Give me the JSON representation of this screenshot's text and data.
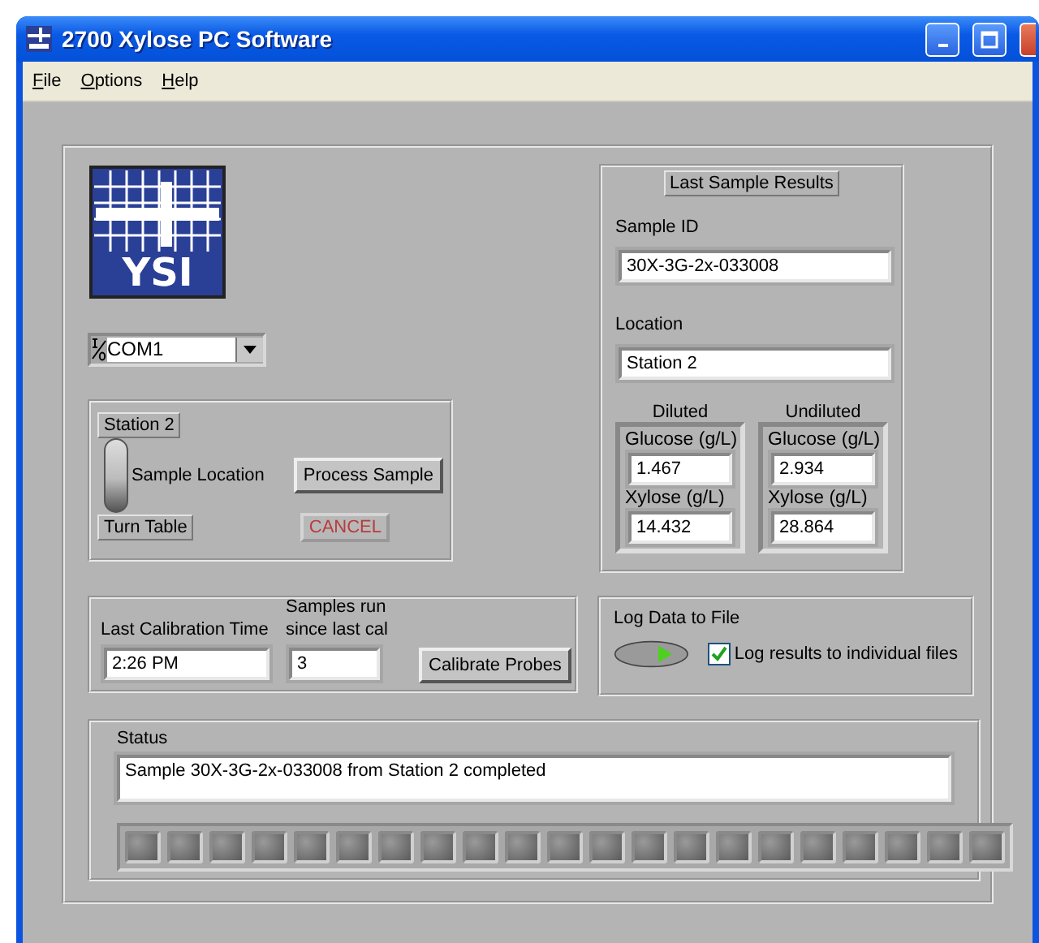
{
  "window": {
    "title": "2700 Xylose PC Software"
  },
  "menu": [
    {
      "label": "File"
    },
    {
      "label": "Options"
    },
    {
      "label": "Help"
    }
  ],
  "logo": {
    "text": "YSI"
  },
  "port": {
    "value": "COM1"
  },
  "station_panel": {
    "station_label": "Station 2",
    "switch": {
      "on": true
    },
    "switch_label": "Sample Location",
    "turntable_label": "Turn Table",
    "process_button": "Process Sample",
    "cancel_button": {
      "label": "CANCEL",
      "disabled": true
    }
  },
  "results": {
    "title": "Last Sample Results",
    "sample_id": {
      "label": "Sample ID",
      "value": "30X-3G-2x-033008"
    },
    "location": {
      "label": "Location",
      "value": "Station 2"
    },
    "groups": [
      {
        "heading": "Diluted",
        "fields": [
          {
            "label": "Glucose (g/L)",
            "value": "1.467"
          },
          {
            "label": "Xylose (g/L)",
            "value": "14.432"
          }
        ]
      },
      {
        "heading": "Undiluted",
        "fields": [
          {
            "label": "Glucose (g/L)",
            "value": "2.934"
          },
          {
            "label": "Xylose (g/L)",
            "value": "28.864"
          }
        ]
      }
    ]
  },
  "calibration": {
    "time_label": "Last Calibration Time",
    "time_value": "2:26 PM",
    "samples_label": "Samples run since last cal",
    "samples_value": "3",
    "button": "Calibrate Probes"
  },
  "logging": {
    "title": "Log Data to File",
    "checkbox": {
      "label": "Log results to individual files",
      "checked": true
    }
  },
  "status": {
    "label": "Status",
    "message": "Sample 30X-3G-2x-033008 from Station 2 completed",
    "progress": {
      "level": 0
    }
  }
}
